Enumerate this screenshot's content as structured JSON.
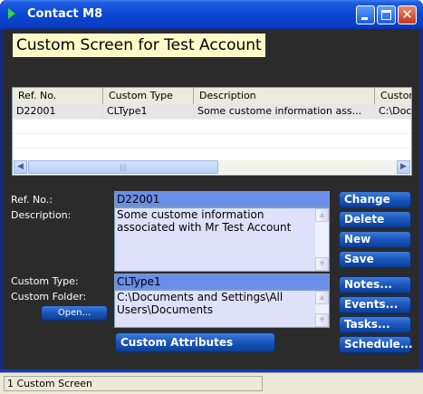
{
  "window": {
    "title": "Contact M8"
  },
  "header": {
    "title": "Custom Screen for Test Account"
  },
  "grid": {
    "columns": [
      "Ref. No.",
      "Custom Type",
      "Description",
      "Custom Folder"
    ],
    "rows": [
      [
        "D22001",
        "CLType1",
        "Some custome information ass...",
        "C:\\Documents and Settings\\All Users\\Documents"
      ]
    ]
  },
  "form": {
    "ref_label": "Ref. No.:",
    "ref_value": "D22001",
    "description_label": "Description:",
    "description_value": "Some custome information associated with Mr Test Account",
    "custom_type_label": "Custom Type:",
    "custom_type_value": "CLType1",
    "custom_folder_label": "Custom Folder:",
    "custom_folder_value": "C:\\Documents and Settings\\All Users\\Documents",
    "open_label": "Open...",
    "custom_attributes_label": "Custom Attributes"
  },
  "actions": {
    "change": "Change",
    "delete": "Delete",
    "new": "New",
    "save": "Save",
    "notes": "Notes...",
    "events": "Events...",
    "tasks": "Tasks...",
    "schedule": "Schedule..."
  },
  "status": {
    "text": "1 Custom Screen"
  }
}
